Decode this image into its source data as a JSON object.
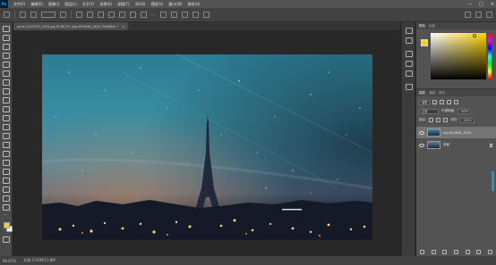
{
  "menubar": {
    "logo": "Ps",
    "items": [
      "文件(F)",
      "编辑(E)",
      "图像(I)",
      "图层(L)",
      "文字(Y)",
      "选择(S)",
      "滤镜(T)",
      "3D(D)",
      "视图(V)",
      "窗口(W)",
      "帮助(H)"
    ],
    "window_controls": [
      "—",
      "□",
      "✕"
    ]
  },
  "document": {
    "tab_title": "paris-1245970_1920.jpg @ 66.7% (sky-829846_1920, RGB/8#) *",
    "close_glyph": "×"
  },
  "status": {
    "zoom": "66.67%",
    "doc_info": "文档:5.93M/11.8M"
  },
  "color_panel": {
    "tabs": [
      "颜色",
      "色板"
    ],
    "fg_color": "#f2d21e",
    "bg_color": "#f5f5f5"
  },
  "layers_panel": {
    "tabs": [
      "图层",
      "通道",
      "路径"
    ],
    "filter_kind": "类型",
    "blend_mode": "正常",
    "opacity_label": "不透明度:",
    "opacity_value": "100%",
    "lock_label": "锁定:",
    "fill_label": "填充:",
    "fill_value": "100%",
    "layers": [
      {
        "name": "sky-829846_1920",
        "selected": true
      },
      {
        "name": "背景",
        "selected": false
      }
    ]
  },
  "colors": {
    "accent": "#2f8fbd",
    "chrome": "#535353"
  },
  "icons": [
    "ps-logo",
    "move-icon",
    "marquee-icon",
    "lasso-icon",
    "crop-icon",
    "eyedropper-icon",
    "brush-icon",
    "eraser-icon",
    "gradient-icon",
    "pen-icon",
    "text-icon",
    "hand-icon",
    "zoom-icon",
    "eye-icon",
    "lock-icon",
    "search-icon",
    "home-icon"
  ]
}
